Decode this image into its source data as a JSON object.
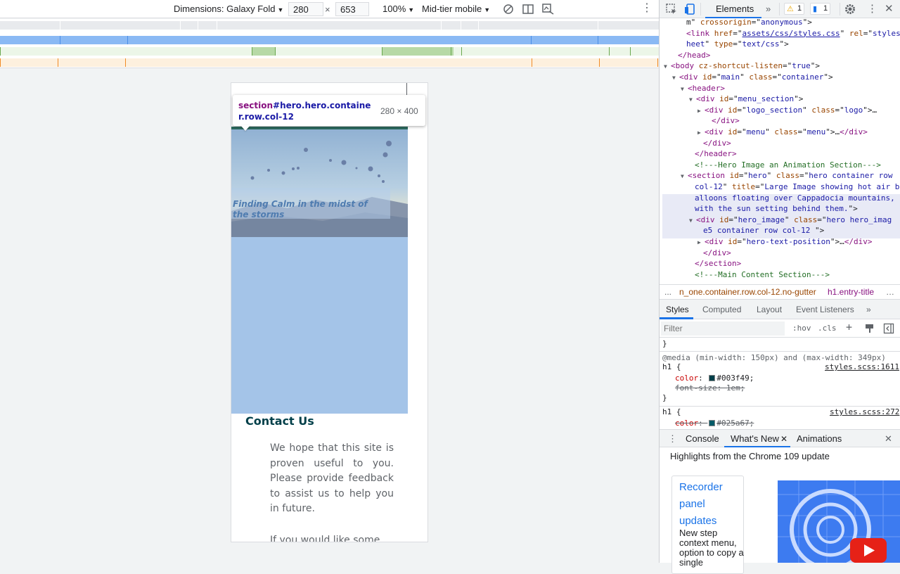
{
  "device_toolbar": {
    "dimensions_label": "Dimensions: Galaxy Fold",
    "width_value": "280",
    "times": "×",
    "height_value": "653",
    "zoom": "100%",
    "throttling": "Mid-tier mobile"
  },
  "tooltip": {
    "tag": "section",
    "selector": "#hero.hero.container.row.col-12",
    "size": "280 × 400"
  },
  "page": {
    "hero_text": "Finding Calm in the midst of the storms",
    "contact_title": "Contact Us",
    "contact_p1": "We hope that this site is proven useful to you. Please provide feedback to assist us to help you in future.",
    "contact_p2": "If you would like some"
  },
  "devtools": {
    "tab_elements": "Elements",
    "more_tabs": "»",
    "warnings": "1",
    "messages": "1",
    "dom_lines": [
      {
        "indent": 38,
        "parts": [
          [
            "tx",
            "m\" "
          ],
          [
            "an",
            "crossorigin"
          ],
          [
            "tx",
            "=\""
          ],
          [
            "av",
            "anonymous"
          ],
          [
            "tx",
            "\">"
          ]
        ]
      },
      {
        "indent": 38,
        "parts": [
          [
            "tg",
            "<link "
          ],
          [
            "an",
            "href"
          ],
          [
            "tx",
            "=\""
          ],
          [
            "lk",
            "assets/css/styles.css"
          ],
          [
            "tx",
            "\" "
          ],
          [
            "an",
            "rel"
          ],
          [
            "tx",
            "=\""
          ],
          [
            "av",
            "styles"
          ]
        ]
      },
      {
        "indent": 38,
        "parts": [
          [
            "av",
            "heet"
          ],
          [
            "tx",
            "\" "
          ],
          [
            "an",
            "type"
          ],
          [
            "tx",
            "=\""
          ],
          [
            "av",
            "text/css"
          ],
          [
            "tx",
            "\">"
          ]
        ]
      },
      {
        "indent": 26,
        "parts": [
          [
            "tg",
            "</head>"
          ]
        ]
      },
      {
        "indent": 18,
        "tri": "▼",
        "parts": [
          [
            "tg",
            "<body "
          ],
          [
            "an",
            "cz-shortcut-listen"
          ],
          [
            "tx",
            "=\""
          ],
          [
            "av",
            "true"
          ],
          [
            "tx",
            "\">"
          ]
        ]
      },
      {
        "indent": 30,
        "tri": "▼",
        "parts": [
          [
            "tg",
            "<div "
          ],
          [
            "an",
            "id"
          ],
          [
            "tx",
            "=\""
          ],
          [
            "av",
            "main"
          ],
          [
            "tx",
            "\" "
          ],
          [
            "an",
            "class"
          ],
          [
            "tx",
            "=\""
          ],
          [
            "av",
            "container"
          ],
          [
            "tx",
            "\">"
          ]
        ]
      },
      {
        "indent": 42,
        "tri": "▼",
        "parts": [
          [
            "tg",
            "<header>"
          ]
        ]
      },
      {
        "indent": 54,
        "tri": "▼",
        "parts": [
          [
            "tg",
            "<div "
          ],
          [
            "an",
            "id"
          ],
          [
            "tx",
            "=\""
          ],
          [
            "av",
            "menu_section"
          ],
          [
            "tx",
            "\">"
          ]
        ]
      },
      {
        "indent": 66,
        "tri": "▶",
        "parts": [
          [
            "tg",
            "<div "
          ],
          [
            "an",
            "id"
          ],
          [
            "tx",
            "=\""
          ],
          [
            "av",
            "logo_section"
          ],
          [
            "tx",
            "\" "
          ],
          [
            "an",
            "class"
          ],
          [
            "tx",
            "=\""
          ],
          [
            "av",
            "logo"
          ],
          [
            "tx",
            "\">…"
          ]
        ]
      },
      {
        "indent": 74,
        "parts": [
          [
            "tg",
            "</div>"
          ]
        ]
      },
      {
        "indent": 66,
        "tri": "▶",
        "parts": [
          [
            "tg",
            "<div "
          ],
          [
            "an",
            "id"
          ],
          [
            "tx",
            "=\""
          ],
          [
            "av",
            "menu"
          ],
          [
            "tx",
            "\" "
          ],
          [
            "an",
            "class"
          ],
          [
            "tx",
            "=\""
          ],
          [
            "av",
            "menu"
          ],
          [
            "tx",
            "\">…"
          ],
          [
            "tg",
            "</div>"
          ]
        ]
      },
      {
        "indent": 62,
        "parts": [
          [
            "tg",
            "</div>"
          ]
        ]
      },
      {
        "indent": 50,
        "parts": [
          [
            "tg",
            "</header>"
          ]
        ]
      },
      {
        "indent": 50,
        "parts": [
          [
            "cm",
            "<!---Hero Image an Animation Section--->"
          ]
        ]
      },
      {
        "indent": 42,
        "tri": "▼",
        "parts": [
          [
            "tg",
            "<section "
          ],
          [
            "an",
            "id"
          ],
          [
            "tx",
            "=\""
          ],
          [
            "av",
            "hero"
          ],
          [
            "tx",
            "\" "
          ],
          [
            "an",
            "class"
          ],
          [
            "tx",
            "=\""
          ],
          [
            "av",
            "hero container row"
          ]
        ]
      },
      {
        "indent": 50,
        "parts": [
          [
            "av",
            "col-12"
          ],
          [
            "tx",
            "\" "
          ],
          [
            "an",
            "title"
          ],
          [
            "tx",
            "=\""
          ],
          [
            "av",
            "Large Image showing hot air b"
          ]
        ]
      },
      {
        "indent": 50,
        "parts": [
          [
            "av",
            "alloons floating over Cappadocia mountains,"
          ]
        ]
      },
      {
        "indent": 50,
        "parts": [
          [
            "av",
            "with the sun setting behind them."
          ],
          [
            "tx",
            "\">"
          ]
        ]
      },
      {
        "indent": 54,
        "tri": "▼",
        "parts": [
          [
            "tg",
            "<div "
          ],
          [
            "an",
            "id"
          ],
          [
            "tx",
            "=\""
          ],
          [
            "av",
            "hero_image"
          ],
          [
            "tx",
            "\" "
          ],
          [
            "an",
            "class"
          ],
          [
            "tx",
            "=\""
          ],
          [
            "av",
            "hero hero_imag"
          ]
        ]
      },
      {
        "indent": 62,
        "parts": [
          [
            "av",
            "e5 container row col-12 "
          ],
          [
            "tx",
            "\">"
          ]
        ]
      },
      {
        "indent": 66,
        "tri": "▶",
        "parts": [
          [
            "tg",
            "<div "
          ],
          [
            "an",
            "id"
          ],
          [
            "tx",
            "=\""
          ],
          [
            "av",
            "hero-text-position"
          ],
          [
            "tx",
            "\">…"
          ],
          [
            "tg",
            "</div>"
          ]
        ]
      },
      {
        "indent": 62,
        "parts": [
          [
            "tg",
            "</div>"
          ]
        ]
      },
      {
        "indent": 50,
        "parts": [
          [
            "tg",
            "</section>"
          ]
        ]
      },
      {
        "indent": 50,
        "parts": [
          [
            "cm",
            "<!---Main Content Section--->"
          ]
        ]
      }
    ],
    "breadcrumb": {
      "ellipsis": "...",
      "crumb1": "n_one.container.row.col-12.no-gutter",
      "crumb2": "h1.entry-title",
      "more": "…"
    },
    "styles_tabs": [
      "Styles",
      "Computed",
      "Layout",
      "Event Listeners"
    ],
    "styles_more": "»",
    "filter_placeholder": "Filter",
    "hov": ":hov",
    "cls": ".cls",
    "rules": {
      "close1": "}",
      "media": "@media (min-width: 150px) and (max-width: 349px)",
      "sel1": "h1 {",
      "src1": "styles.scss:1611",
      "color_prop": "color",
      "color1": "#003f49",
      "color1_swatch": "#003f49",
      "fontsize_strike": "font-size: 1em;",
      "close2": "}",
      "sel2": "h1 {",
      "src2": "styles.scss:272",
      "color2": "#025a67",
      "color2_swatch": "#025a67"
    },
    "drawer_tabs": [
      "Console",
      "What's New",
      "Animations"
    ],
    "whats_new_heading": "Highlights from the Chrome 109 update",
    "card_title": "Recorder panel updates",
    "card_body": "New step context menu, option to copy a single"
  },
  "colors": {
    "accent": "#1a73e8",
    "contact_title": "#003f49",
    "hero_fill": "#a4c4e8"
  }
}
